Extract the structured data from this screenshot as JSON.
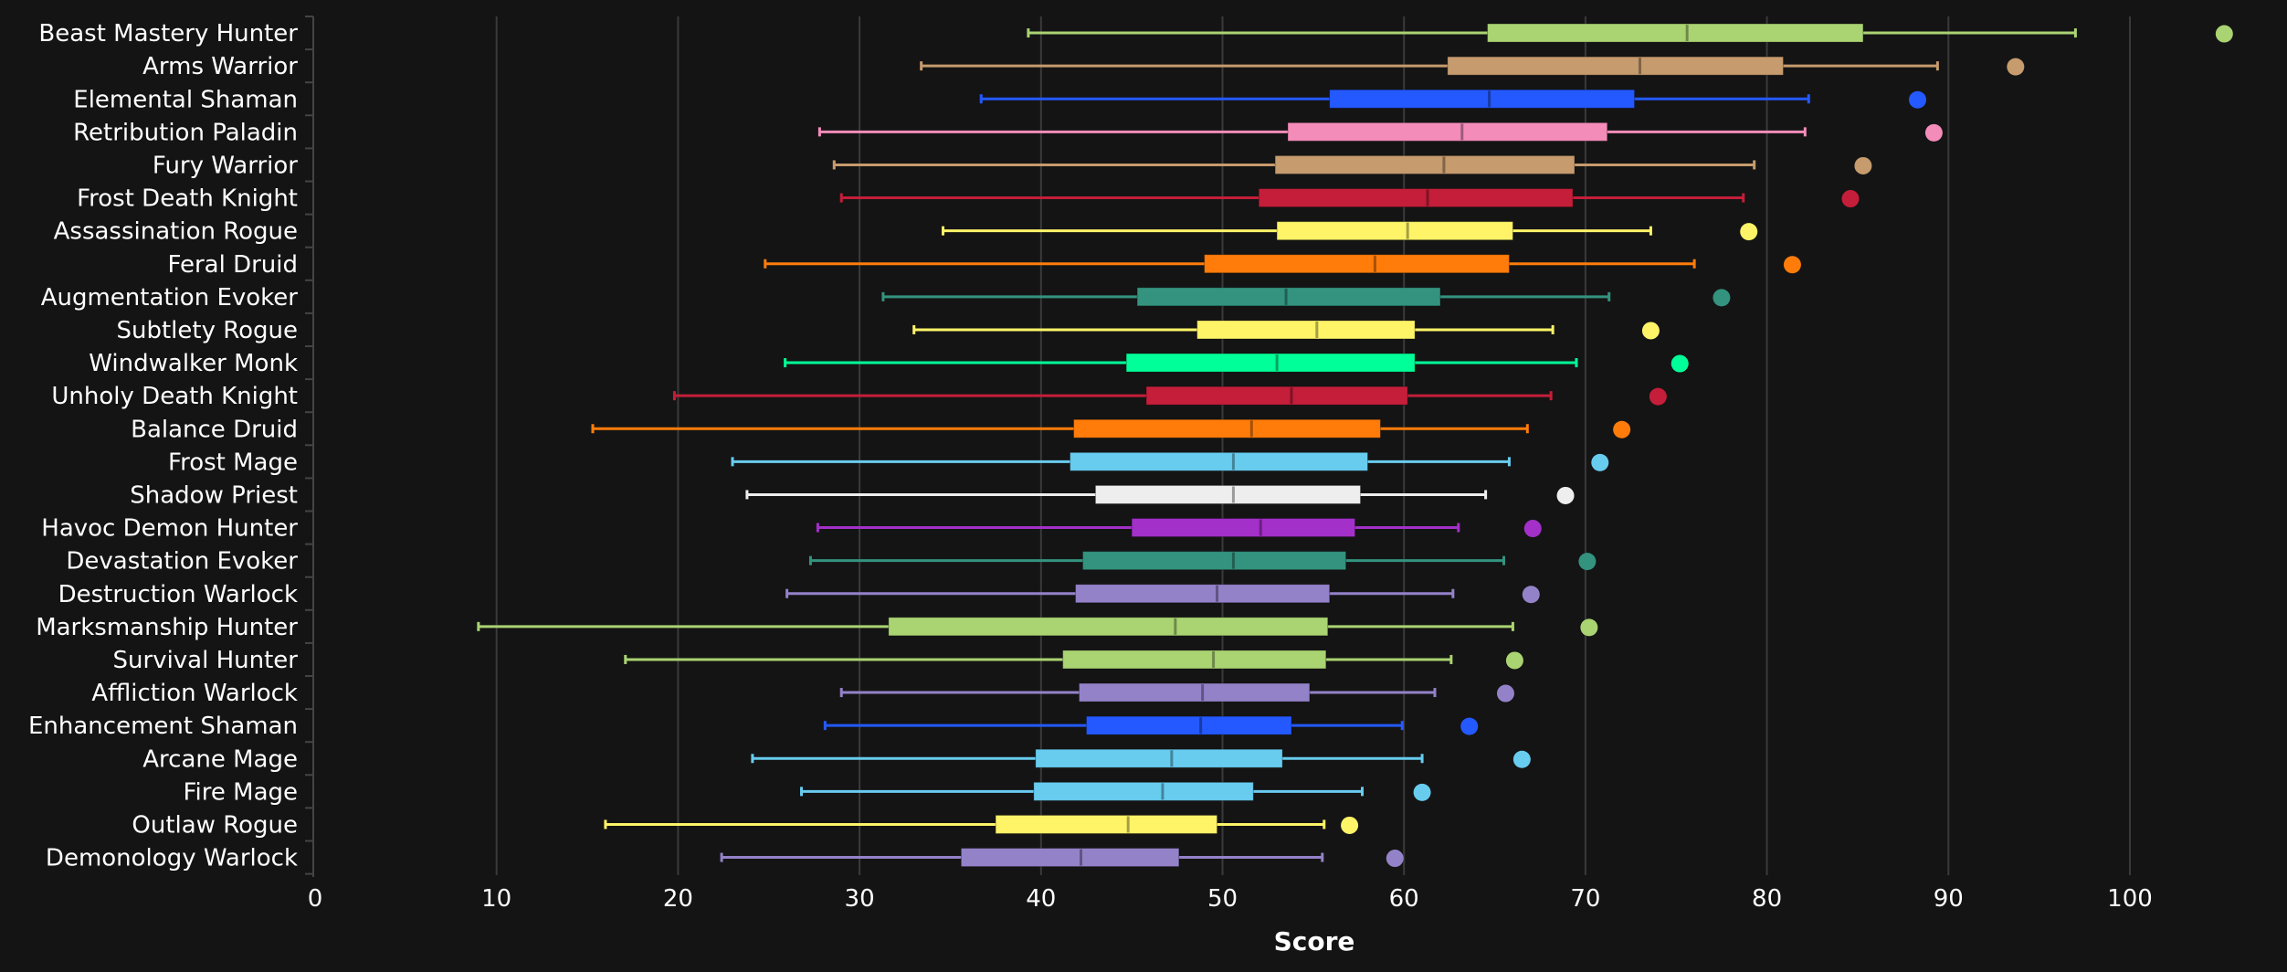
{
  "chart_data": {
    "type": "box",
    "title": "",
    "xlabel": "Score",
    "ylabel": "",
    "xlim": [
      0,
      105
    ],
    "xticks": [
      0,
      10,
      20,
      30,
      40,
      50,
      60,
      70,
      80,
      90,
      100
    ],
    "grid": true,
    "legend": "none",
    "series": [
      {
        "name": "Beast Mastery Hunter",
        "color": "#aad372",
        "min": 39.3,
        "q1": 64.6,
        "median": 75.6,
        "q3": 85.3,
        "max": 97.0,
        "outlier": 105.2
      },
      {
        "name": "Arms Warrior",
        "color": "#c69b6d",
        "min": 33.4,
        "q1": 62.4,
        "median": 73.0,
        "q3": 80.9,
        "max": 89.4,
        "outlier": 93.7
      },
      {
        "name": "Elemental Shaman",
        "color": "#2459ff",
        "min": 36.7,
        "q1": 55.9,
        "median": 64.7,
        "q3": 72.7,
        "max": 82.3,
        "outlier": 88.3
      },
      {
        "name": "Retribution Paladin",
        "color": "#f48cba",
        "min": 27.8,
        "q1": 53.6,
        "median": 63.2,
        "q3": 71.2,
        "max": 82.1,
        "outlier": 89.2
      },
      {
        "name": "Fury Warrior",
        "color": "#c69b6d",
        "min": 28.6,
        "q1": 52.9,
        "median": 62.2,
        "q3": 69.4,
        "max": 79.3,
        "outlier": 85.3
      },
      {
        "name": "Frost Death Knight",
        "color": "#c41e3a",
        "min": 29.0,
        "q1": 52.0,
        "median": 61.3,
        "q3": 69.3,
        "max": 78.7,
        "outlier": 84.6
      },
      {
        "name": "Assassination Rogue",
        "color": "#fff468",
        "min": 34.6,
        "q1": 53.0,
        "median": 60.2,
        "q3": 66.0,
        "max": 73.6,
        "outlier": 79.0
      },
      {
        "name": "Feral Druid",
        "color": "#ff7c0a",
        "min": 24.8,
        "q1": 49.0,
        "median": 58.4,
        "q3": 65.8,
        "max": 76.0,
        "outlier": 81.4
      },
      {
        "name": "Augmentation Evoker",
        "color": "#33937f",
        "min": 31.3,
        "q1": 45.3,
        "median": 53.5,
        "q3": 62.0,
        "max": 71.3,
        "outlier": 77.5
      },
      {
        "name": "Subtlety Rogue",
        "color": "#fff468",
        "min": 33.0,
        "q1": 48.6,
        "median": 55.2,
        "q3": 60.6,
        "max": 68.2,
        "outlier": 73.6
      },
      {
        "name": "Windwalker Monk",
        "color": "#00ff98",
        "min": 25.9,
        "q1": 44.7,
        "median": 53.0,
        "q3": 60.6,
        "max": 69.5,
        "outlier": 75.2
      },
      {
        "name": "Unholy Death Knight",
        "color": "#c41e3a",
        "min": 19.8,
        "q1": 45.8,
        "median": 53.8,
        "q3": 60.2,
        "max": 68.1,
        "outlier": 74.0
      },
      {
        "name": "Balance Druid",
        "color": "#ff7c0a",
        "min": 15.3,
        "q1": 41.8,
        "median": 51.6,
        "q3": 58.7,
        "max": 66.8,
        "outlier": 72.0
      },
      {
        "name": "Frost Mage",
        "color": "#68ccef",
        "min": 23.0,
        "q1": 41.6,
        "median": 50.6,
        "q3": 58.0,
        "max": 65.8,
        "outlier": 70.8
      },
      {
        "name": "Shadow Priest",
        "color": "#eeeeee",
        "min": 23.8,
        "q1": 43.0,
        "median": 50.6,
        "q3": 57.6,
        "max": 64.5,
        "outlier": 68.9
      },
      {
        "name": "Havoc Demon Hunter",
        "color": "#a330c9",
        "min": 27.7,
        "q1": 45.0,
        "median": 52.1,
        "q3": 57.3,
        "max": 63.0,
        "outlier": 67.1
      },
      {
        "name": "Devastation Evoker",
        "color": "#33937f",
        "min": 27.3,
        "q1": 42.3,
        "median": 50.6,
        "q3": 56.8,
        "max": 65.5,
        "outlier": 70.1
      },
      {
        "name": "Destruction Warlock",
        "color": "#9482c9",
        "min": 26.0,
        "q1": 41.9,
        "median": 49.7,
        "q3": 55.9,
        "max": 62.7,
        "outlier": 67.0
      },
      {
        "name": "Marksmanship Hunter",
        "color": "#aad372",
        "min": 9.0,
        "q1": 31.6,
        "median": 47.4,
        "q3": 55.8,
        "max": 66.0,
        "outlier": 70.2
      },
      {
        "name": "Survival Hunter",
        "color": "#aad372",
        "min": 17.1,
        "q1": 41.2,
        "median": 49.5,
        "q3": 55.7,
        "max": 62.6,
        "outlier": 66.1
      },
      {
        "name": "Affliction Warlock",
        "color": "#9482c9",
        "min": 29.0,
        "q1": 42.1,
        "median": 48.9,
        "q3": 54.8,
        "max": 61.7,
        "outlier": 65.6
      },
      {
        "name": "Enhancement Shaman",
        "color": "#2459ff",
        "min": 28.1,
        "q1": 42.5,
        "median": 48.8,
        "q3": 53.8,
        "max": 59.9,
        "outlier": 63.6
      },
      {
        "name": "Arcane Mage",
        "color": "#68ccef",
        "min": 24.1,
        "q1": 39.7,
        "median": 47.2,
        "q3": 53.3,
        "max": 61.0,
        "outlier": 66.5
      },
      {
        "name": "Fire Mage",
        "color": "#68ccef",
        "min": 26.8,
        "q1": 39.6,
        "median": 46.7,
        "q3": 51.7,
        "max": 57.7,
        "outlier": 61.0
      },
      {
        "name": "Outlaw Rogue",
        "color": "#fff468",
        "min": 16.0,
        "q1": 37.5,
        "median": 44.8,
        "q3": 49.7,
        "max": 55.6,
        "outlier": 57.0
      },
      {
        "name": "Demonology Warlock",
        "color": "#9482c9",
        "min": 22.4,
        "q1": 35.6,
        "median": 42.2,
        "q3": 47.6,
        "max": 55.5,
        "outlier": 59.5
      }
    ]
  }
}
